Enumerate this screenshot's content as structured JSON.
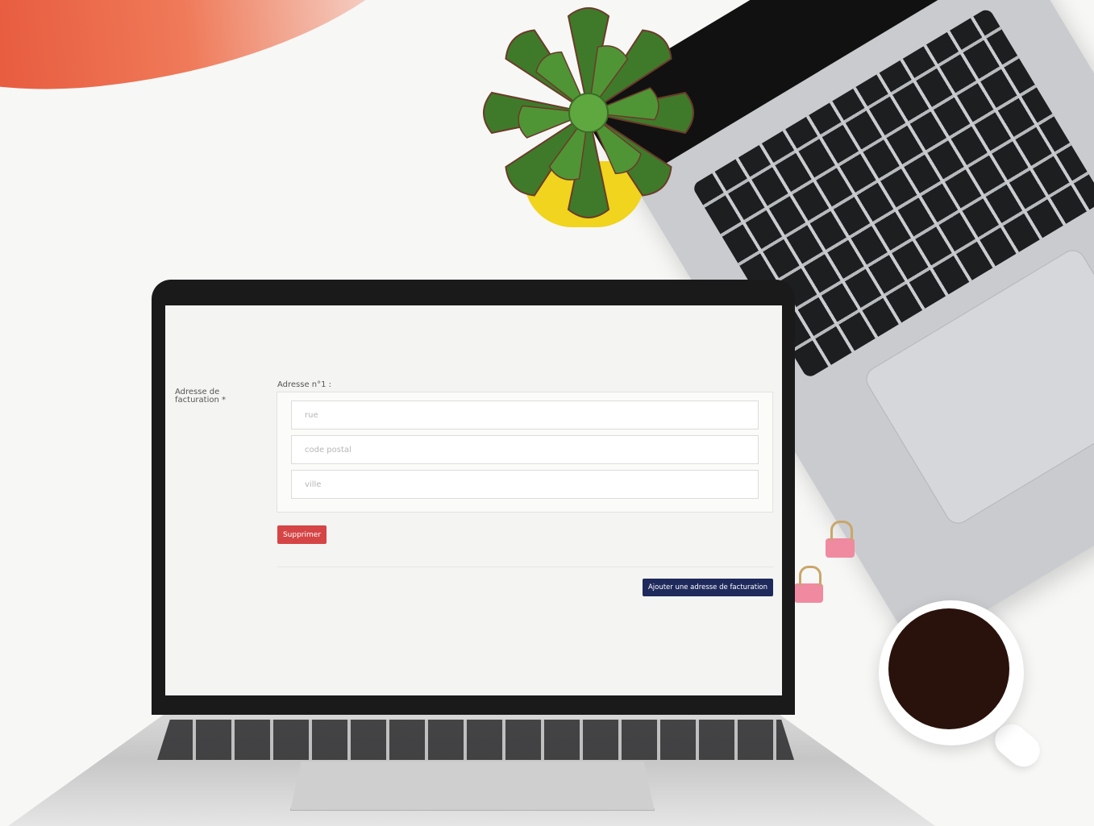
{
  "form": {
    "billing_label": "Adresse de facturation *",
    "address_title": "Adresse n°1 :",
    "fields": {
      "street_placeholder": "rue",
      "postal_placeholder": "code postal",
      "city_placeholder": "ville"
    },
    "delete_label": "Supprimer",
    "add_label": "Ajouter une adresse de facturation"
  },
  "colors": {
    "delete_button": "#d64545",
    "add_button": "#1f2a5c",
    "accent_swoosh": "#e2452c"
  }
}
